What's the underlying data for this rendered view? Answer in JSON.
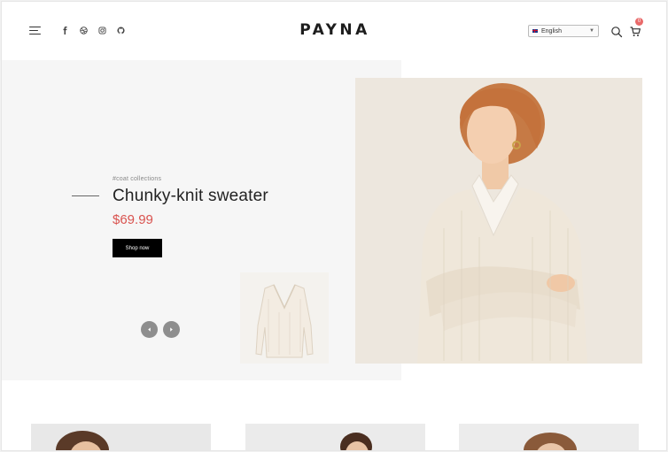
{
  "header": {
    "logo": "PAYNA",
    "social_icons": [
      "facebook-icon",
      "dribbble-icon",
      "instagram-icon",
      "github-icon"
    ],
    "language": {
      "flag": "uk-flag-icon",
      "selected": "English"
    },
    "cart_count": "0"
  },
  "hero": {
    "eyebrow": "#coat collections",
    "title": "Chunky-knit sweater",
    "price": "$69.99",
    "cta_label": "Shop now",
    "prev_icon": "chevron-left-icon",
    "next_icon": "chevron-right-icon"
  },
  "colors": {
    "accent_price": "#d9534f",
    "cart_badge": "#e96a6a",
    "button_bg": "#000000",
    "hero_bg": "#f6f6f6"
  },
  "products": [
    {
      "image": "product-image-1"
    },
    {
      "image": "product-image-2"
    },
    {
      "image": "product-image-3"
    }
  ]
}
